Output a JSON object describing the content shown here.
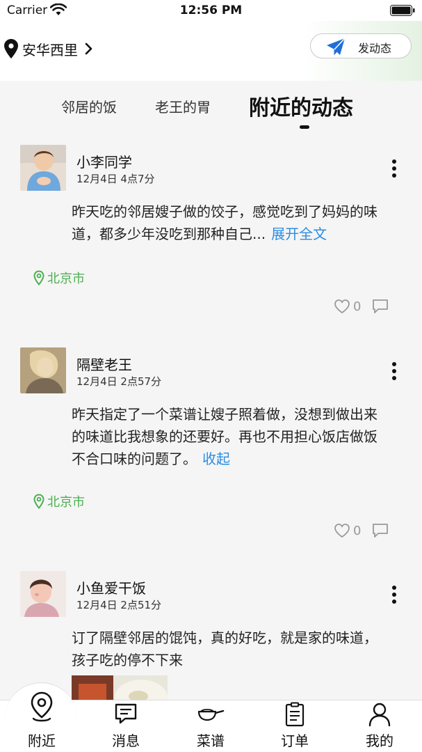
{
  "status_bar": {
    "carrier": "Carrier",
    "time": "12:56 PM"
  },
  "header": {
    "location": "安华西里",
    "post_button": "发动态"
  },
  "tabs": [
    {
      "label": "邻居的饭",
      "active": false
    },
    {
      "label": "老王的胃",
      "active": false
    },
    {
      "label": "附近的动态",
      "active": true
    }
  ],
  "posts": [
    {
      "author": "小李同学",
      "time": "12月4日 4点7分",
      "text": "昨天吃的邻居嫂子做的饺子，感觉吃到了妈妈的味道，都多少年没吃到那种自己...",
      "link": "展开全文",
      "location": "北京市",
      "likes": "0"
    },
    {
      "author": "隔壁老王",
      "time": "12月4日 2点57分",
      "text": "昨天指定了一个菜谱让嫂子照着做，没想到做出来的味道比我想象的还要好。再也不用担心饭店做饭不合口味的问题了。",
      "link": "收起",
      "location": "北京市",
      "likes": "0"
    },
    {
      "author": "小鱼爱干饭",
      "time": "12月4日 2点51分",
      "text": "订了隔壁邻居的馄饨，真的好吃，就是家的味道，孩子吃的停不下来"
    }
  ],
  "bottom_nav": [
    {
      "label": "附近",
      "icon": "location-pin-icon",
      "active": true
    },
    {
      "label": "消息",
      "icon": "message-icon"
    },
    {
      "label": "菜谱",
      "icon": "pan-icon"
    },
    {
      "label": "订单",
      "icon": "clipboard-icon"
    },
    {
      "label": "我的",
      "icon": "person-icon"
    }
  ],
  "colors": {
    "accent_green": "#4caf50",
    "link_blue": "#2a8de3",
    "send_icon": "#1e6fd9"
  }
}
